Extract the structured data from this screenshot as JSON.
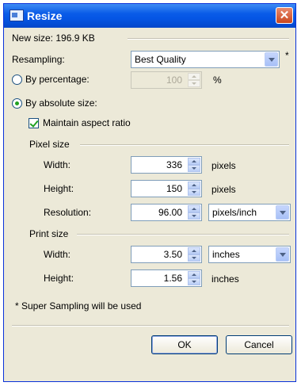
{
  "window": {
    "title": "Resize"
  },
  "new_size": "New size: 196.9 KB",
  "resampling": {
    "label": "Resampling:",
    "value": "Best Quality",
    "asterisk": "*"
  },
  "by_percentage": {
    "label": "By percentage:",
    "value": "100",
    "unit": "%",
    "checked": false
  },
  "by_absolute": {
    "label": "By absolute size:",
    "checked": true
  },
  "maintain_aspect": {
    "label": "Maintain aspect ratio",
    "checked": true
  },
  "pixel_size": {
    "group_label": "Pixel size",
    "width": {
      "label": "Width:",
      "value": "336",
      "unit": "pixels"
    },
    "height": {
      "label": "Height:",
      "value": "150",
      "unit": "pixels"
    },
    "resolution": {
      "label": "Resolution:",
      "value": "96.00",
      "unit": "pixels/inch"
    }
  },
  "print_size": {
    "group_label": "Print size",
    "width": {
      "label": "Width:",
      "value": "3.50",
      "unit": "inches"
    },
    "height": {
      "label": "Height:",
      "value": "1.56",
      "unit": "inches"
    }
  },
  "footnote": "* Super Sampling will be used",
  "buttons": {
    "ok": "OK",
    "cancel": "Cancel"
  },
  "icons": {
    "title": "resize-window-icon",
    "close": "close-icon"
  }
}
